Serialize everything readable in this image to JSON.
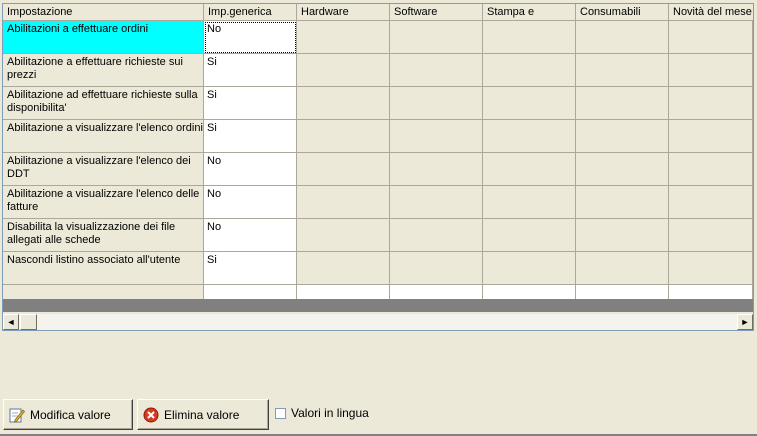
{
  "grid": {
    "columns": [
      "Impostazione",
      "Imp.generica",
      "Hardware",
      "Software",
      "Stampa e",
      "Consumabili",
      "Novità del mese"
    ],
    "rows": [
      {
        "label": "Abilitazioni a effettuare ordini",
        "value": "No"
      },
      {
        "label": "Abilitazione a effettuare richieste sui prezzi",
        "value": "Si"
      },
      {
        "label": "Abilitazione ad effettuare richieste sulla disponibilita'",
        "value": "Si"
      },
      {
        "label": "Abilitazione a visualizzare l'elenco ordini",
        "value": "Si"
      },
      {
        "label": "Abilitazione a visualizzare l'elenco dei DDT",
        "value": "No"
      },
      {
        "label": "Abilitazione a visualizzare l'elenco delle fatture",
        "value": "No"
      },
      {
        "label": "Disabilita la visualizzazione dei file allegati alle schede",
        "value": "No"
      },
      {
        "label": "Nascondi listino associato all'utente",
        "value": "Si"
      }
    ]
  },
  "scrollbar": {
    "left_arrow": "◄",
    "right_arrow": "►"
  },
  "buttons": {
    "modifica": "Modifica valore",
    "elimina": "Elimina valore"
  },
  "checkbox": {
    "label": "Valori in lingua",
    "checked": false
  },
  "icons": {
    "modifica": "edit-pencil-icon",
    "elimina": "delete-x-icon"
  }
}
